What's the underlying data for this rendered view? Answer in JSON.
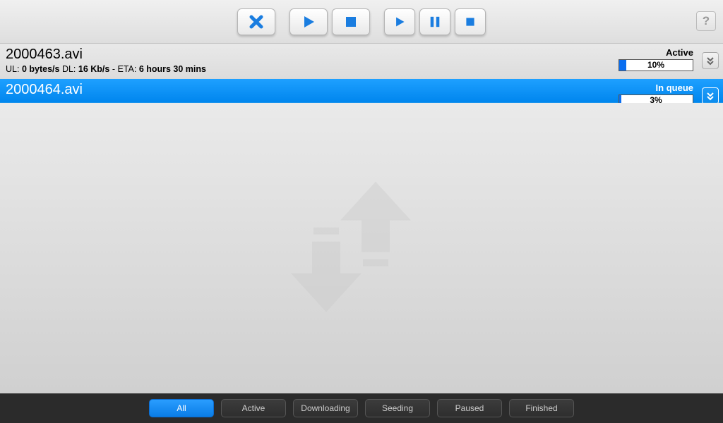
{
  "toolbar": {
    "help_label": "?"
  },
  "torrents": [
    {
      "filename": "2000463.avi",
      "ul_label": "UL:",
      "ul_value": "0 bytes/s",
      "dl_label": "DL:",
      "dl_value": "16 Kb/s",
      "eta_label": "ETA:",
      "eta_value": "6 hours 30 mins",
      "status": "Active",
      "percent_text": "10%",
      "percent": 10
    },
    {
      "filename": "2000464.avi",
      "status": "In queue",
      "percent_text": "3%",
      "percent": 3
    }
  ],
  "filters": {
    "all": "All",
    "active": "Active",
    "downloading": "Downloading",
    "seeding": "Seeding",
    "paused": "Paused",
    "finished": "Finished"
  },
  "colors": {
    "accent": "#0a86f0",
    "selected": "#1ea0ff"
  }
}
